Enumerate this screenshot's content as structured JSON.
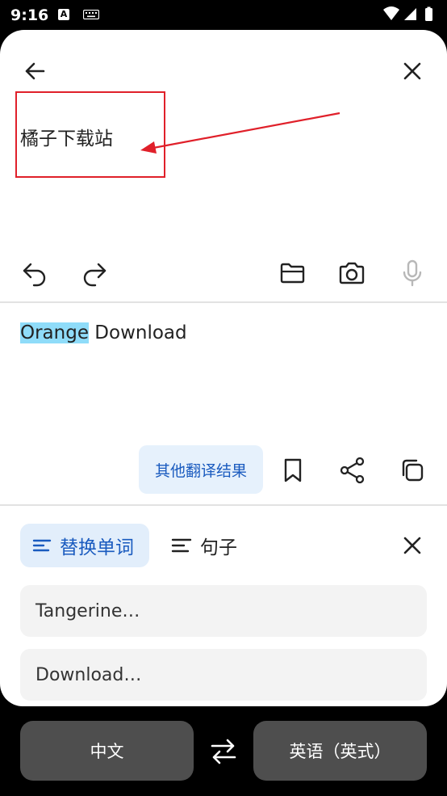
{
  "status_bar": {
    "time": "9:16",
    "notif_letter": "A"
  },
  "input": {
    "text": "橘子下载站"
  },
  "output": {
    "highlight_word": "Orange",
    "rest": " Download"
  },
  "actions": {
    "other_results_label": "其他翻译结果"
  },
  "tabs": {
    "replace_word_label": "替换单词",
    "sentence_label": "句子"
  },
  "suggestions": [
    {
      "text": "Tangerine…"
    },
    {
      "text": "Download…"
    }
  ],
  "languages": {
    "source": "中文",
    "target": "英语（英式）"
  },
  "colors": {
    "accent": "#1a5bbf",
    "highlight": "#8fdcf9",
    "annotation": "#e0202a"
  }
}
